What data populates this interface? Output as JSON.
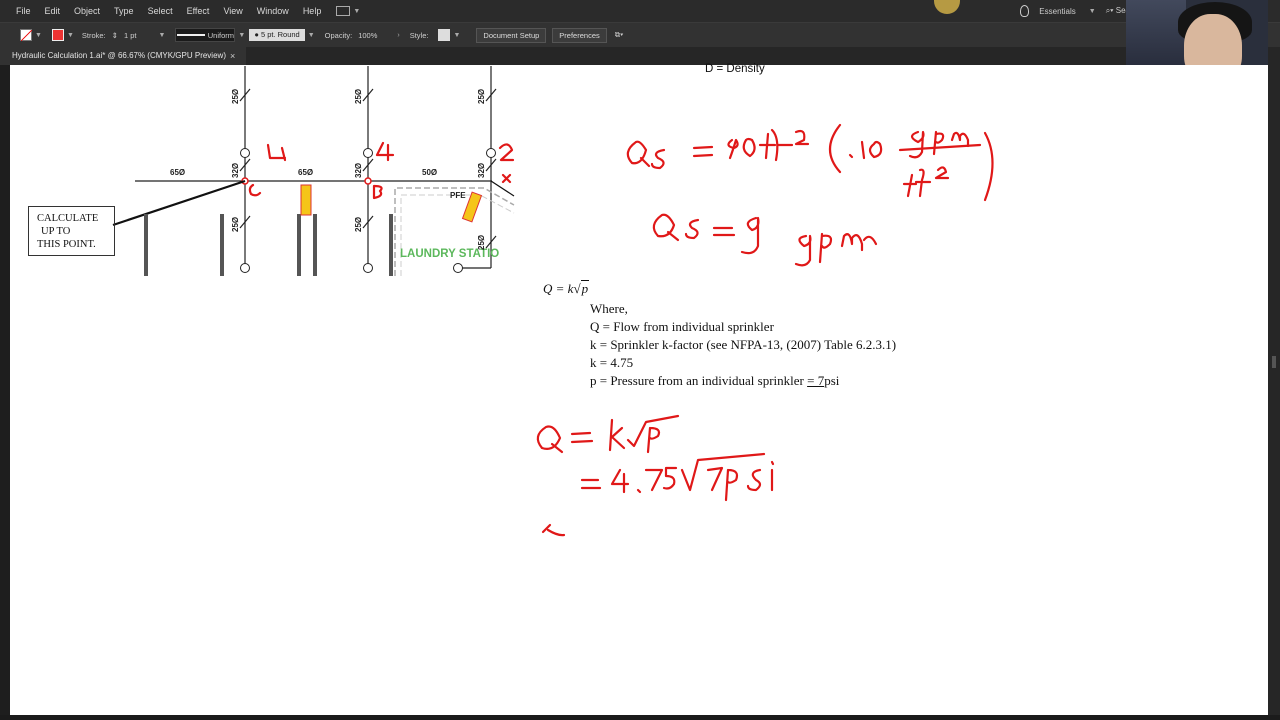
{
  "menubar": {
    "items": [
      "File",
      "Edit",
      "Object",
      "Type",
      "Select",
      "Effect",
      "View",
      "Window",
      "Help"
    ],
    "workspace": "Essentials",
    "search_placeholder": "Sea"
  },
  "controlbar": {
    "stroke_label": "Stroke:",
    "stroke_weight": "1 pt",
    "profile": "Uniform",
    "brush": "5 pt. Round",
    "opacity_label": "Opacity:",
    "opacity_value": "100%",
    "style_label": "Style:",
    "document_setup": "Document Setup",
    "preferences": "Preferences"
  },
  "tab": {
    "title": "Hydraulic Calculation 1.ai* @ 66.67% (CMYK/GPU Preview)",
    "close": "×"
  },
  "artboard": {
    "density_line": "D = Density",
    "callout": [
      "CALCULATE",
      "UP TO",
      "THIS POINT."
    ],
    "laundry": "LAUNDRY STATIO",
    "pfe": "PFE",
    "pipe_labels_h": [
      "65Ø",
      "65Ø",
      "50Ø"
    ],
    "pipe_labels_v": [
      "25Ø",
      "25Ø",
      "25Ø",
      "32Ø",
      "32Ø",
      "32Ø",
      "25Ø",
      "25Ø",
      "25Ø"
    ],
    "formula": {
      "lhs": "Q = k",
      "rad": "p"
    },
    "where": [
      "Where,",
      "Q = Flow from individual sprinkler",
      "k = Sprinkler k-factor (see NFPA-13, (2007) Table 6.2.3.1)",
      "k = 4.75"
    ],
    "pressure_prefix": "p = Pressure from an individual sprinkler ",
    "pressure_value": "= 7",
    "pressure_unit": "psi"
  },
  "colors": {
    "ink_red": "#e01818",
    "laundry_green": "#5cb85c",
    "yellow": "#f5c518"
  }
}
